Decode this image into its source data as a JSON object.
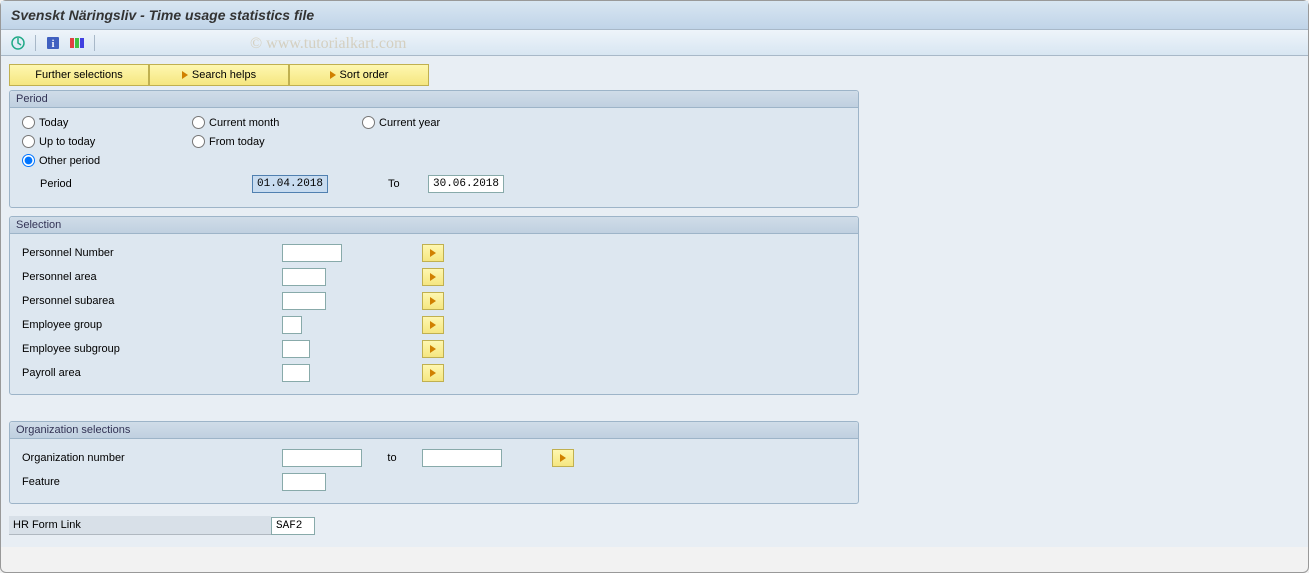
{
  "window": {
    "title": "Svenskt Näringsliv - Time usage statistics file"
  },
  "watermark": "© www.tutorialkart.com",
  "buttons": {
    "further_selections": "Further selections",
    "search_helps": "Search helps",
    "sort_order": "Sort order"
  },
  "period": {
    "legend": "Period",
    "today": "Today",
    "current_month": "Current month",
    "current_year": "Current year",
    "up_to_today": "Up to today",
    "from_today": "From today",
    "other_period": "Other period",
    "period_label": "Period",
    "from_value": "01.04.2018",
    "to_label": "To",
    "to_value": "30.06.2018"
  },
  "selection": {
    "legend": "Selection",
    "rows": [
      {
        "label": "Personnel Number",
        "width": "mid"
      },
      {
        "label": "Personnel area",
        "width": "mid"
      },
      {
        "label": "Personnel subarea",
        "width": "mid"
      },
      {
        "label": "Employee group",
        "width": "narrow"
      },
      {
        "label": "Employee subgroup",
        "width": "narrow"
      },
      {
        "label": "Payroll area",
        "width": "narrow"
      }
    ]
  },
  "org": {
    "legend": "Organization selections",
    "org_number": "Organization number",
    "to": "to",
    "feature": "Feature"
  },
  "hr_form": {
    "label": "HR Form Link",
    "value": "SAF2"
  }
}
